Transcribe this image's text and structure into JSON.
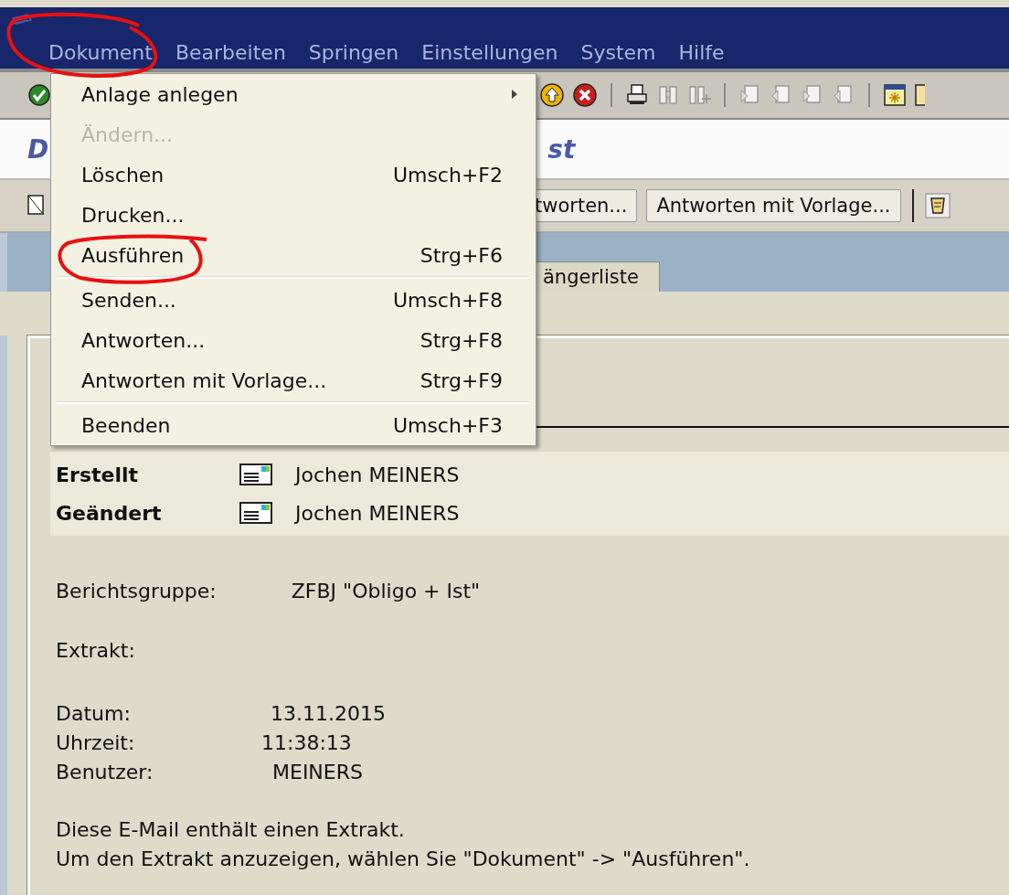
{
  "menu_bar": [
    {
      "label": "Dokument"
    },
    {
      "label": "Bearbeiten"
    },
    {
      "label": "Springen"
    },
    {
      "label": "Einstellungen"
    },
    {
      "label": "System"
    },
    {
      "label": "Hilfe"
    }
  ],
  "title_fragments": [
    "D",
    "st"
  ],
  "app_toolbar": {
    "buttons": [
      "tworten...",
      "Antworten mit Vorlage..."
    ]
  },
  "tabs": [
    {
      "label": "ängerliste"
    }
  ],
  "dropdown_menu": {
    "items": [
      {
        "kind": "item",
        "label": "Anlage anlegen",
        "submenu": true,
        "disabled": false
      },
      {
        "kind": "item",
        "label": "Ändern...",
        "disabled": true
      },
      {
        "kind": "item",
        "label": "Löschen",
        "shortcut": "Umsch+F2",
        "disabled": false
      },
      {
        "kind": "item",
        "label": "Drucken...",
        "disabled": false
      },
      {
        "kind": "item",
        "label": "Ausführen",
        "shortcut": "Strg+F6",
        "disabled": false
      },
      {
        "kind": "separator"
      },
      {
        "kind": "item",
        "label": "Senden...",
        "shortcut": "Umsch+F8",
        "disabled": false
      },
      {
        "kind": "item",
        "label": "Antworten...",
        "shortcut": "Strg+F8",
        "disabled": false
      },
      {
        "kind": "item",
        "label": "Antworten mit Vorlage...",
        "shortcut": "Strg+F9",
        "disabled": false
      },
      {
        "kind": "separator"
      },
      {
        "kind": "item",
        "label": "Beenden",
        "shortcut": "Umsch+F3",
        "disabled": false
      }
    ]
  },
  "author_rows": [
    {
      "label": "Erstellt",
      "name": "Jochen MEINERS"
    },
    {
      "label": "Geändert",
      "name": "Jochen MEINERS"
    }
  ],
  "report_group": {
    "label": "Berichtsgruppe:",
    "value": "ZFBJ \"Obligo + Ist\""
  },
  "extract_label": "Extrakt:",
  "details": [
    {
      "label": "Datum:",
      "value": "13.11.2015"
    },
    {
      "label": "Uhrzeit:",
      "value": "11:38:13"
    },
    {
      "label": "Benutzer:",
      "value": "MEINERS"
    }
  ],
  "message": [
    "Diese E-Mail enthält einen Extrakt.",
    "Um den Extrakt anzuzeigen, wählen Sie \"Dokument\" -> \"Ausführen\"."
  ]
}
